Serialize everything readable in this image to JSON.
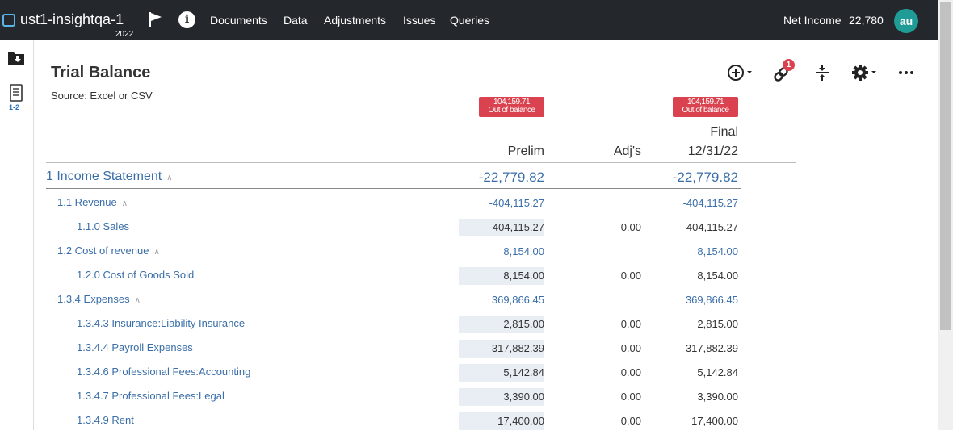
{
  "topbar": {
    "app_name": "ust1-insightqa-1",
    "year": "2022",
    "nav": [
      "Documents",
      "Data",
      "Adjustments",
      "Issues",
      "Queries"
    ],
    "net_income_label": "Net Income",
    "net_income_value": "22,780",
    "avatar": "au"
  },
  "rail": {
    "count_label": "1-2"
  },
  "page": {
    "title": "Trial Balance",
    "source": "Source: Excel or CSV"
  },
  "toolbar": {
    "link_badge": "1",
    "icons": [
      "add-icon",
      "link-icon",
      "collapse-icon",
      "gear-icon",
      "more-icon"
    ]
  },
  "badges": {
    "prelim": {
      "amount": "104,159.71",
      "status": "Out of balance"
    },
    "final": {
      "amount": "104,159.71",
      "status": "Out of balance"
    }
  },
  "columns": {
    "prelim": "Prelim",
    "adj": "Adj's",
    "final_line1": "Final",
    "final_line2": "12/31/22"
  },
  "rows": [
    {
      "level": 0,
      "label": "1 Income Statement",
      "collapsible": true,
      "prelim": "-22,779.82",
      "adj": "",
      "final": "-22,779.82"
    },
    {
      "level": 1,
      "label": "1.1 Revenue",
      "collapsible": true,
      "prelim": "-404,115.27",
      "adj": "",
      "final": "-404,115.27"
    },
    {
      "level": 2,
      "label": "1.1.0 Sales",
      "collapsible": false,
      "prelim": "-404,115.27",
      "adj": "0.00",
      "final": "-404,115.27"
    },
    {
      "level": 1,
      "label": "1.2 Cost of revenue",
      "collapsible": true,
      "prelim": "8,154.00",
      "adj": "",
      "final": "8,154.00"
    },
    {
      "level": 2,
      "label": "1.2.0 Cost of Goods Sold",
      "collapsible": false,
      "prelim": "8,154.00",
      "adj": "0.00",
      "final": "8,154.00"
    },
    {
      "level": 1,
      "label": "1.3.4 Expenses",
      "collapsible": true,
      "prelim": "369,866.45",
      "adj": "",
      "final": "369,866.45"
    },
    {
      "level": 2,
      "label": "1.3.4.3 Insurance:Liability Insurance",
      "collapsible": false,
      "prelim": "2,815.00",
      "adj": "0.00",
      "final": "2,815.00"
    },
    {
      "level": 2,
      "label": "1.3.4.4 Payroll Expenses",
      "collapsible": false,
      "prelim": "317,882.39",
      "adj": "0.00",
      "final": "317,882.39"
    },
    {
      "level": 2,
      "label": "1.3.4.6 Professional Fees:Accounting",
      "collapsible": false,
      "prelim": "5,142.84",
      "adj": "0.00",
      "final": "5,142.84"
    },
    {
      "level": 2,
      "label": "1.3.4.7 Professional Fees:Legal",
      "collapsible": false,
      "prelim": "3,390.00",
      "adj": "0.00",
      "final": "3,390.00"
    },
    {
      "level": 2,
      "label": "1.3.4.9 Rent",
      "collapsible": false,
      "prelim": "17,400.00",
      "adj": "0.00",
      "final": "17,400.00"
    }
  ]
}
